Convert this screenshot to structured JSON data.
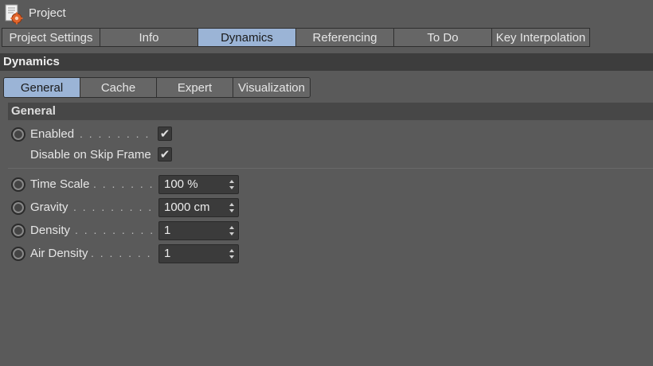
{
  "window": {
    "title": "Project",
    "icon": "project-gear-icon"
  },
  "top_tabs": [
    {
      "label": "Project Settings",
      "active": false
    },
    {
      "label": "Info",
      "active": false
    },
    {
      "label": "Dynamics",
      "active": true
    },
    {
      "label": "Referencing",
      "active": false
    },
    {
      "label": "To Do",
      "active": false
    },
    {
      "label": "Key Interpolation",
      "active": false
    }
  ],
  "section": {
    "title": "Dynamics"
  },
  "sub_tabs": [
    {
      "label": "General",
      "active": true
    },
    {
      "label": "Cache",
      "active": false
    },
    {
      "label": "Expert",
      "active": false
    },
    {
      "label": "Visualization",
      "active": false
    }
  ],
  "group": {
    "title": "General"
  },
  "checks": {
    "enabled": {
      "label": "Enabled",
      "dots": ". . . . . . . . . . .",
      "checked": true,
      "mark": "✔"
    },
    "disable_skip": {
      "label": "Disable on Skip Frame",
      "checked": true,
      "mark": "✔"
    }
  },
  "fields": {
    "time_scale": {
      "label": "Time Scale",
      "dots": ". . . . . . . . .",
      "value": "100 %"
    },
    "gravity": {
      "label": "Gravity",
      "dots": ". . . . . . . . . . . .",
      "value": "1000 cm"
    },
    "density": {
      "label": "Density",
      "dots": ". . . . . . . . . . . .",
      "value": "1"
    },
    "air_density": {
      "label": "Air Density",
      "dots": ". . . . . . . . . .",
      "value": "1"
    }
  },
  "colors": {
    "background": "#5a5a5a",
    "active_tab": "#9bb4d6",
    "section_header": "#3d3d3d"
  }
}
